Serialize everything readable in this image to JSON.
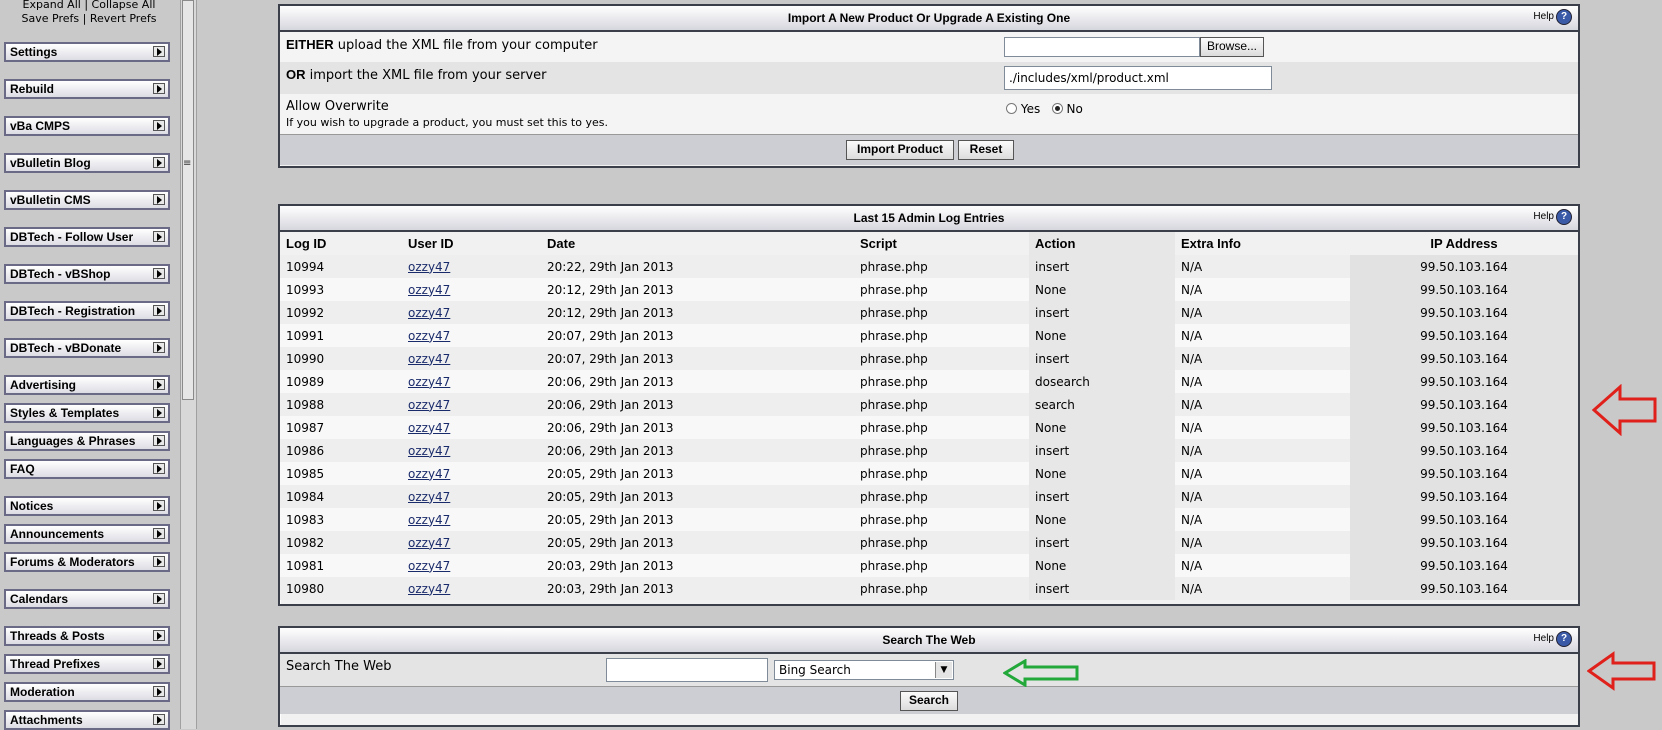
{
  "sidebar": {
    "top_links": {
      "expand_all": "Expand All",
      "collapse_all": "Collapse All",
      "save_prefs": "Save Prefs",
      "revert_prefs": "Revert Prefs",
      "separator": "|"
    },
    "groups": [
      "Settings",
      "Rebuild",
      "vBa CMPS",
      "vBulletin Blog",
      "vBulletin CMS",
      "DBTech - Follow User",
      "DBTech - vBShop",
      "DBTech - Registration",
      "DBTech - vBDonate",
      "Advertising",
      "Styles & Templates",
      "Languages & Phrases",
      "FAQ",
      "Notices",
      "Announcements",
      "Forums & Moderators",
      "Calendars",
      "Threads & Posts",
      "Thread Prefixes",
      "Moderation",
      "Attachments"
    ]
  },
  "import_panel": {
    "title": "Import A New Product Or Upgrade A Existing One",
    "help": "Help",
    "help_icon": "?",
    "row1": {
      "bold": "EITHER",
      "text": " upload the XML file from your computer",
      "browse_label": "Browse..."
    },
    "row2": {
      "bold": "OR",
      "text": " import the XML file from your server",
      "value": "./includes/xml/product.xml"
    },
    "row3": {
      "label": "Allow Overwrite",
      "desc": "If you wish to upgrade a product, you must set this to yes.",
      "yes": "Yes",
      "no": "No",
      "selected": "No"
    },
    "import_button": "Import Product",
    "reset_button": "Reset"
  },
  "log_panel": {
    "title": "Last 15 Admin Log Entries",
    "help": "Help",
    "help_icon": "?",
    "columns": [
      "Log ID",
      "User ID",
      "Date",
      "Script",
      "Action",
      "Extra Info",
      "IP Address"
    ],
    "rows": [
      [
        "10994",
        "ozzy47",
        "20:22, 29th Jan 2013",
        "phrase.php",
        "insert",
        "N/A",
        "99.50.103.164"
      ],
      [
        "10993",
        "ozzy47",
        "20:12, 29th Jan 2013",
        "phrase.php",
        "None",
        "N/A",
        "99.50.103.164"
      ],
      [
        "10992",
        "ozzy47",
        "20:12, 29th Jan 2013",
        "phrase.php",
        "insert",
        "N/A",
        "99.50.103.164"
      ],
      [
        "10991",
        "ozzy47",
        "20:07, 29th Jan 2013",
        "phrase.php",
        "None",
        "N/A",
        "99.50.103.164"
      ],
      [
        "10990",
        "ozzy47",
        "20:07, 29th Jan 2013",
        "phrase.php",
        "insert",
        "N/A",
        "99.50.103.164"
      ],
      [
        "10989",
        "ozzy47",
        "20:06, 29th Jan 2013",
        "phrase.php",
        "dosearch",
        "N/A",
        "99.50.103.164"
      ],
      [
        "10988",
        "ozzy47",
        "20:06, 29th Jan 2013",
        "phrase.php",
        "search",
        "N/A",
        "99.50.103.164"
      ],
      [
        "10987",
        "ozzy47",
        "20:06, 29th Jan 2013",
        "phrase.php",
        "None",
        "N/A",
        "99.50.103.164"
      ],
      [
        "10986",
        "ozzy47",
        "20:06, 29th Jan 2013",
        "phrase.php",
        "insert",
        "N/A",
        "99.50.103.164"
      ],
      [
        "10985",
        "ozzy47",
        "20:05, 29th Jan 2013",
        "phrase.php",
        "None",
        "N/A",
        "99.50.103.164"
      ],
      [
        "10984",
        "ozzy47",
        "20:05, 29th Jan 2013",
        "phrase.php",
        "insert",
        "N/A",
        "99.50.103.164"
      ],
      [
        "10983",
        "ozzy47",
        "20:05, 29th Jan 2013",
        "phrase.php",
        "None",
        "N/A",
        "99.50.103.164"
      ],
      [
        "10982",
        "ozzy47",
        "20:05, 29th Jan 2013",
        "phrase.php",
        "insert",
        "N/A",
        "99.50.103.164"
      ],
      [
        "10981",
        "ozzy47",
        "20:03, 29th Jan 2013",
        "phrase.php",
        "None",
        "N/A",
        "99.50.103.164"
      ],
      [
        "10980",
        "ozzy47",
        "20:03, 29th Jan 2013",
        "phrase.php",
        "insert",
        "N/A",
        "99.50.103.164"
      ]
    ]
  },
  "search_panel": {
    "title": "Search The Web",
    "help": "Help",
    "help_icon": "?",
    "label": "Search The Web",
    "query": "",
    "engine": "Bing Search",
    "search_button": "Search"
  },
  "colors": {
    "red_arrow": "#e0201a",
    "green_arrow": "#23a83a",
    "panel_border": "#3a3f4a",
    "link": "#1a2b6b"
  },
  "icons": {
    "nav_expand": "right-triangle-icon",
    "help": "question-mark-icon",
    "annotation_red": "red-arrow-left-icon",
    "annotation_green": "green-arrow-left-icon",
    "select_dropdown": "chevron-down-icon"
  }
}
